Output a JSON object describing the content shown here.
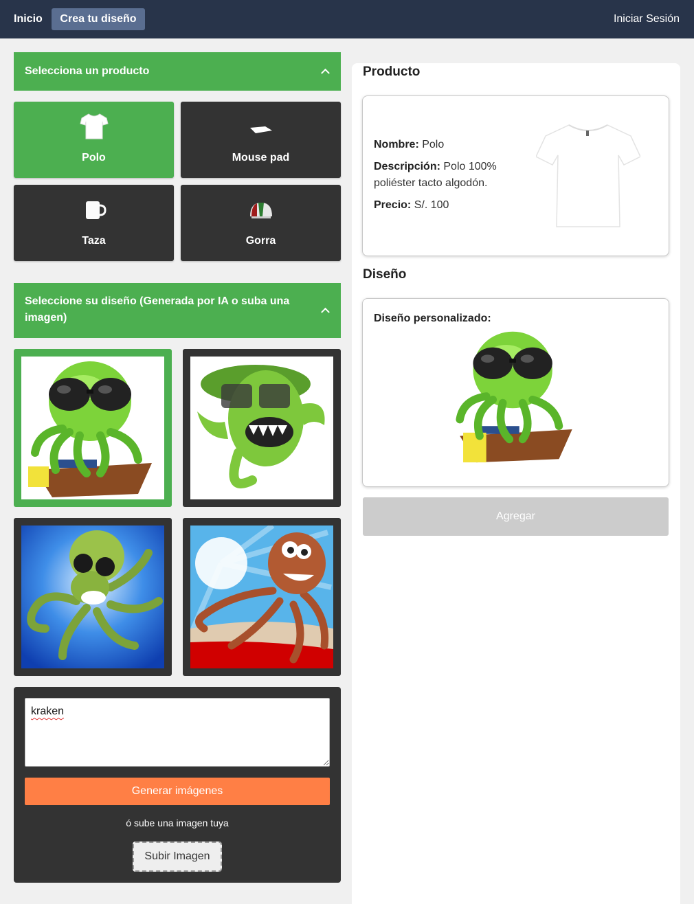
{
  "nav": {
    "home": "Inicio",
    "create": "Crea tu diseño",
    "login": "Iniciar Sesión"
  },
  "products_section": {
    "title": "Selecciona un producto",
    "items": [
      {
        "label": "Polo",
        "icon": "tshirt-icon",
        "selected": true
      },
      {
        "label": "Mouse pad",
        "icon": "mousepad-icon",
        "selected": false
      },
      {
        "label": "Taza",
        "icon": "mug-icon",
        "selected": false
      },
      {
        "label": "Gorra",
        "icon": "cap-icon",
        "selected": false
      }
    ]
  },
  "design_section": {
    "title": "Seleccione su diseño (Generada por IA o suba una imagen)",
    "images": [
      {
        "name": "green-octopus-sunglasses-boat",
        "selected": true
      },
      {
        "name": "green-monster-glasses",
        "selected": false
      },
      {
        "name": "green-octopus-blue-rays",
        "selected": false
      },
      {
        "name": "brown-octopus-beach",
        "selected": false
      }
    ]
  },
  "prompt": {
    "value": "kraken",
    "generate_label": "Generar imágenes",
    "upload_hint": "ó sube una imagen tuya",
    "upload_label": "Subir Imagen"
  },
  "product_panel": {
    "title": "Producto",
    "name_label": "Nombre:",
    "name_value": "Polo",
    "desc_label": "Descripción:",
    "desc_value_line1": "Polo 100%",
    "desc_value_line2": "poliéster tacto algodón.",
    "price_label": "Precio:",
    "price_value": "S/. 100"
  },
  "design_panel": {
    "title": "Diseño",
    "custom_label": "Diseño personalizado:"
  },
  "add_button": "Agregar",
  "colors": {
    "nav_bg": "#28344a",
    "accent_green": "#4caf50",
    "card_dark": "#333333",
    "orange": "#ff7f45",
    "disabled": "#cccccc"
  }
}
